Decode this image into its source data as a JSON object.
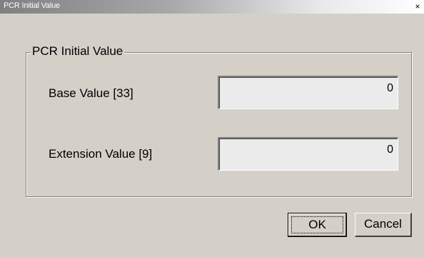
{
  "window": {
    "title": "PCR Initial Value",
    "close_glyph": "×"
  },
  "group": {
    "label": "PCR Initial Value"
  },
  "fields": {
    "base_label": "Base Value [33]",
    "base_value": "0",
    "ext_label": "Extension Value [9]",
    "ext_value": "0"
  },
  "buttons": {
    "ok_label": "OK",
    "cancel_label": "Cancel"
  },
  "colors": {
    "dialog_background": "#d4d0c8",
    "field_background": "#ebebeb"
  }
}
